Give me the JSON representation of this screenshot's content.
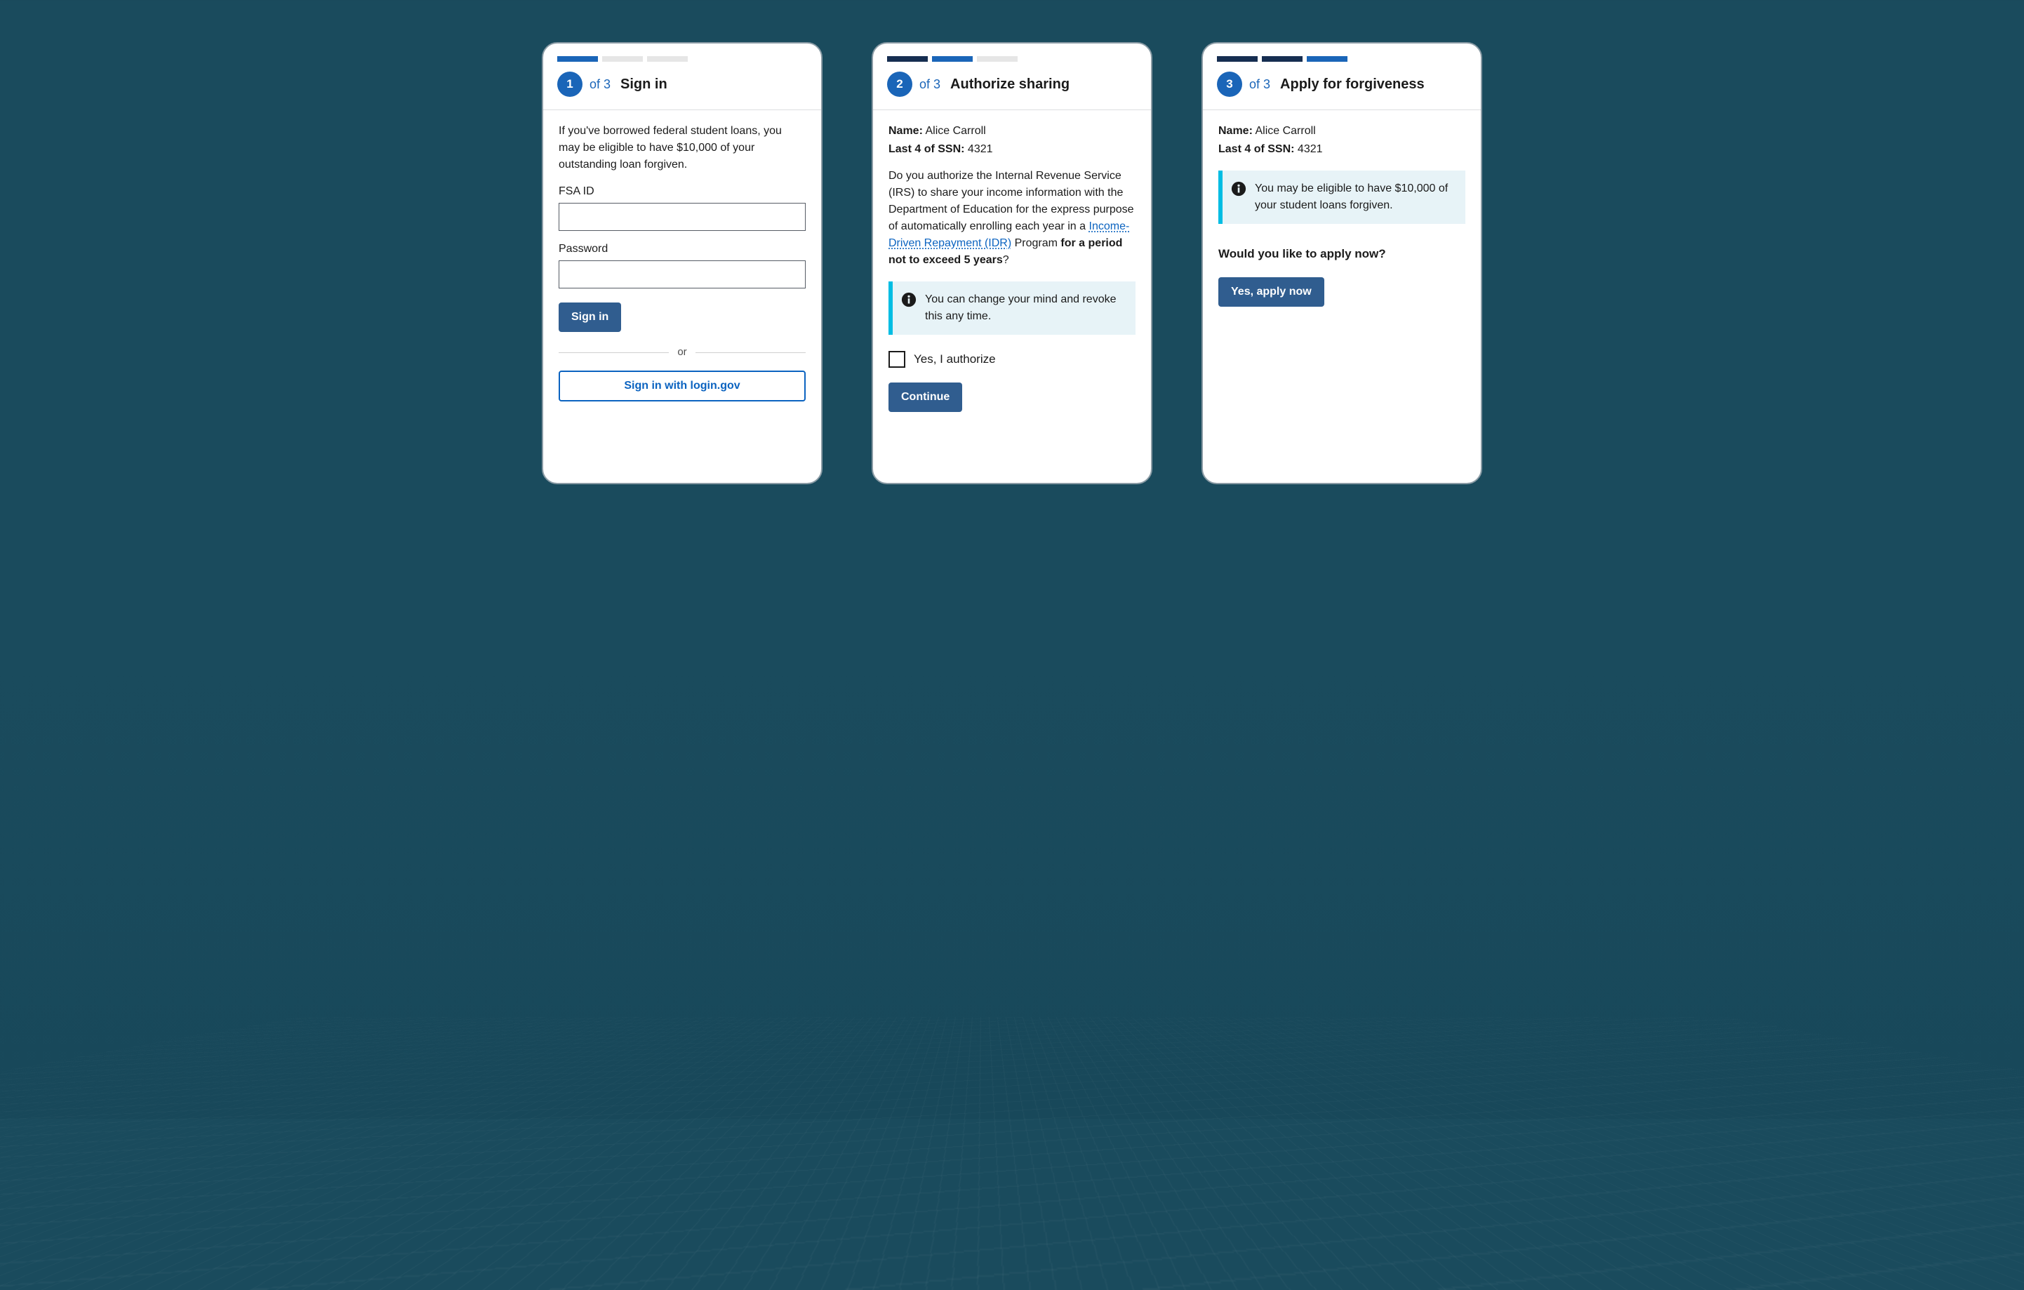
{
  "common": {
    "of_label": "of 3",
    "user_name_label": "Name:",
    "user_name": "Alice Carroll",
    "ssn_label": "Last 4 of SSN:",
    "ssn_last4": "4321"
  },
  "step1": {
    "number": "1",
    "title": "Sign in",
    "intro": "If you've borrowed federal student loans, you may be eligible to have $10,000 of your outstanding loan forgiven.",
    "fsa_label": "FSA ID",
    "password_label": "Password",
    "signin_button": "Sign in",
    "or_label": "or",
    "login_gov_button": "Sign in with login.gov"
  },
  "step2": {
    "number": "2",
    "title": "Authorize sharing",
    "auth_pre": "Do you authorize the Internal Revenue Service (IRS) to share your income information with the Department of Education for the express purpose of automatically enrolling each year in a ",
    "auth_link": "Income-Driven Repayment (IDR)",
    "auth_mid": " Program ",
    "auth_bold": "for a period not to exceed 5 years",
    "auth_end": "?",
    "info_text": "You can change your mind and revoke this any time.",
    "checkbox_label": "Yes, I authorize",
    "continue_button": "Continue"
  },
  "step3": {
    "number": "3",
    "title": "Apply for forgiveness",
    "info_text": "You may be eligible to have $10,000 of your student loans forgiven.",
    "question": "Would you like to apply now?",
    "apply_button": "Yes, apply now"
  }
}
